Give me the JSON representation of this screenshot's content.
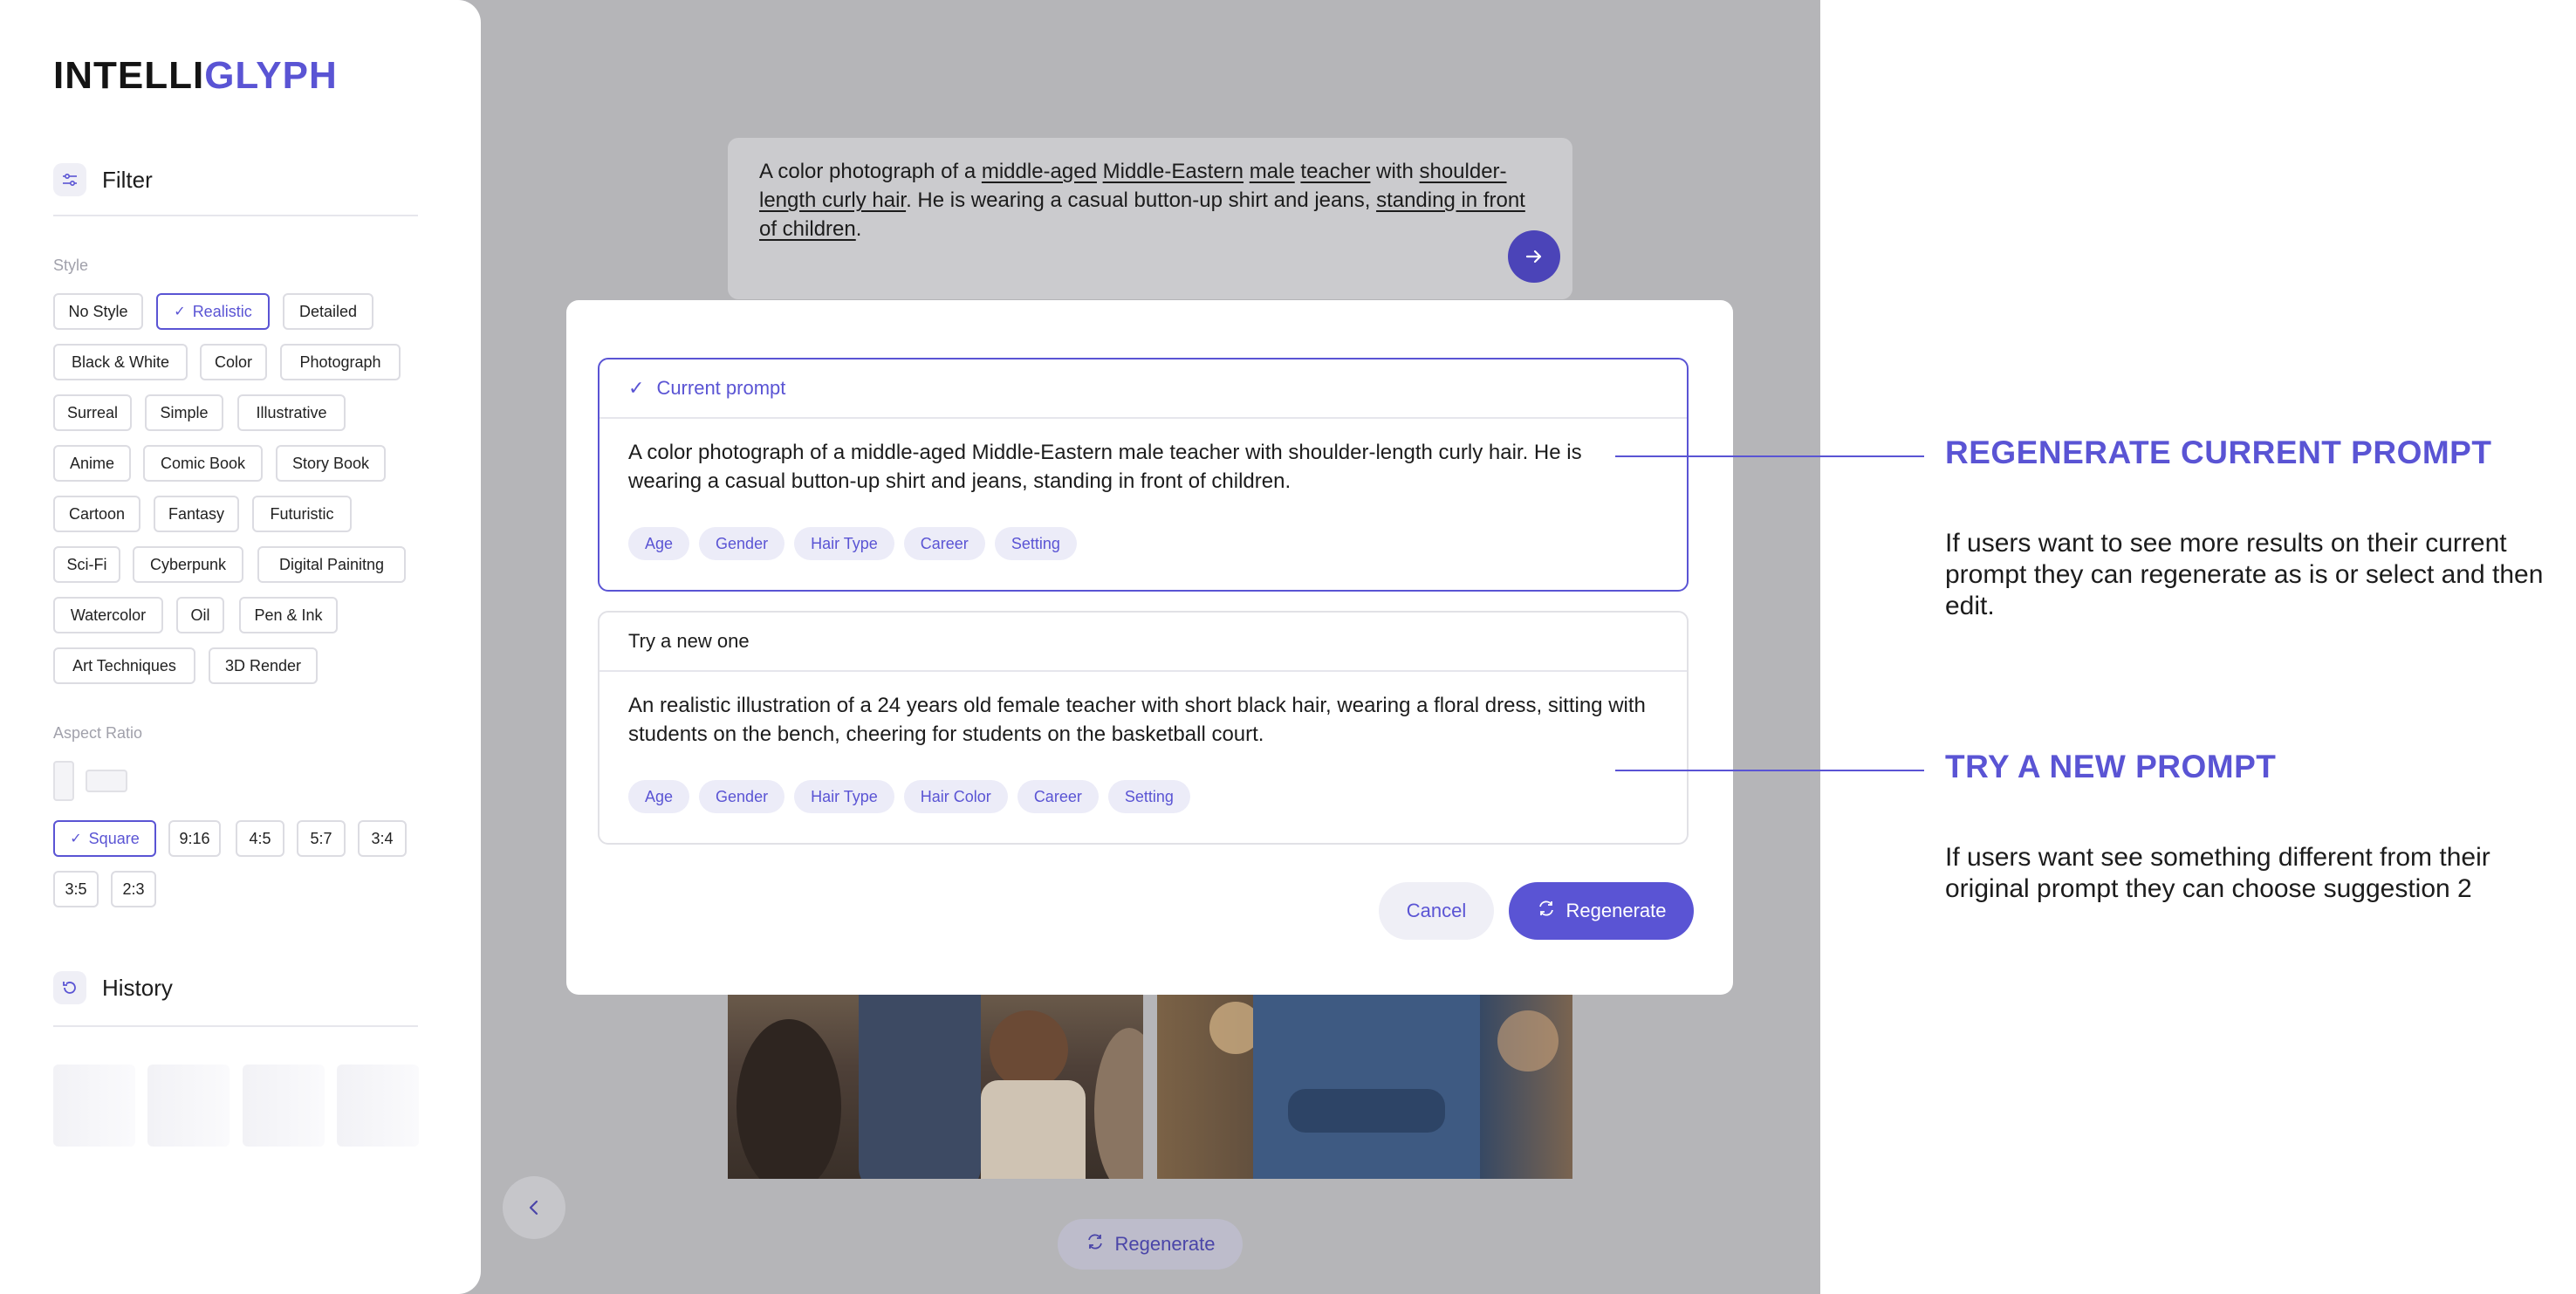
{
  "app": {
    "logo_part1": "INTELLI",
    "logo_part2": "GLYPH"
  },
  "sidebar": {
    "filter_label": "Filter",
    "style_label": "Style",
    "styles": [
      "No Style",
      "Realistic",
      "Detailed",
      "Black & White",
      "Color",
      "Photograph",
      "Surreal",
      "Simple",
      "Illustrative",
      "Anime",
      "Comic Book",
      "Story Book",
      "Cartoon",
      "Fantasy",
      "Futuristic",
      "Sci-Fi",
      "Cyberpunk",
      "Digital Painitng",
      "Watercolor",
      "Oil",
      "Pen & Ink",
      "Art Techniques",
      "3D Render"
    ],
    "selected_style": "Realistic",
    "aspect_label": "Aspect Ratio",
    "ratios": [
      "Square",
      "9:16",
      "4:5",
      "5:7",
      "3:4",
      "3:5",
      "2:3"
    ],
    "selected_ratio": "Square",
    "history_label": "History"
  },
  "main": {
    "prompt_parts": [
      "A color photograph of a ",
      "middle-aged",
      " ",
      "Middle-Eastern",
      " ",
      "male",
      " ",
      "teacher",
      " with ",
      "shoulder-length curly hair",
      ". He is wearing a casual button-up shirt and jeans, ",
      "standing in front of children",
      "."
    ],
    "regenerate_label": "Regenerate"
  },
  "modal": {
    "current": {
      "title": "Current prompt",
      "text": "A color photograph of a middle-aged Middle-Eastern male teacher with shoulder-length curly hair. He is wearing a casual button-up shirt and jeans, standing in front of children.",
      "tags": [
        "Age",
        "Gender",
        "Hair Type",
        "Career",
        "Setting"
      ]
    },
    "new": {
      "title": "Try a new one",
      "text": "An realistic illustration of a 24 years old female teacher with short black hair, wearing a floral dress, sitting with students on the bench, cheering for students on the basketball court.",
      "tags": [
        "Age",
        "Gender",
        "Hair Type",
        "Hair Color",
        "Career",
        "Setting"
      ]
    },
    "cancel_label": "Cancel",
    "regenerate_label": "Regenerate"
  },
  "annotations": {
    "a1_title": "REGENERATE CURRENT PROMPT",
    "a1_desc": "If users want to see more results on their current prompt they can regenerate as is or select and then edit.",
    "a2_title": "TRY A NEW PROMPT",
    "a2_desc": "If users want see something different from their original prompt they can choose suggestion 2"
  },
  "colors": {
    "accent": "#5a54d4",
    "backdrop": "#b5b5b8"
  },
  "icons": [
    "sliders-icon",
    "check-icon",
    "history-icon",
    "arrow-right-icon",
    "chevron-left-icon",
    "refresh-icon"
  ]
}
